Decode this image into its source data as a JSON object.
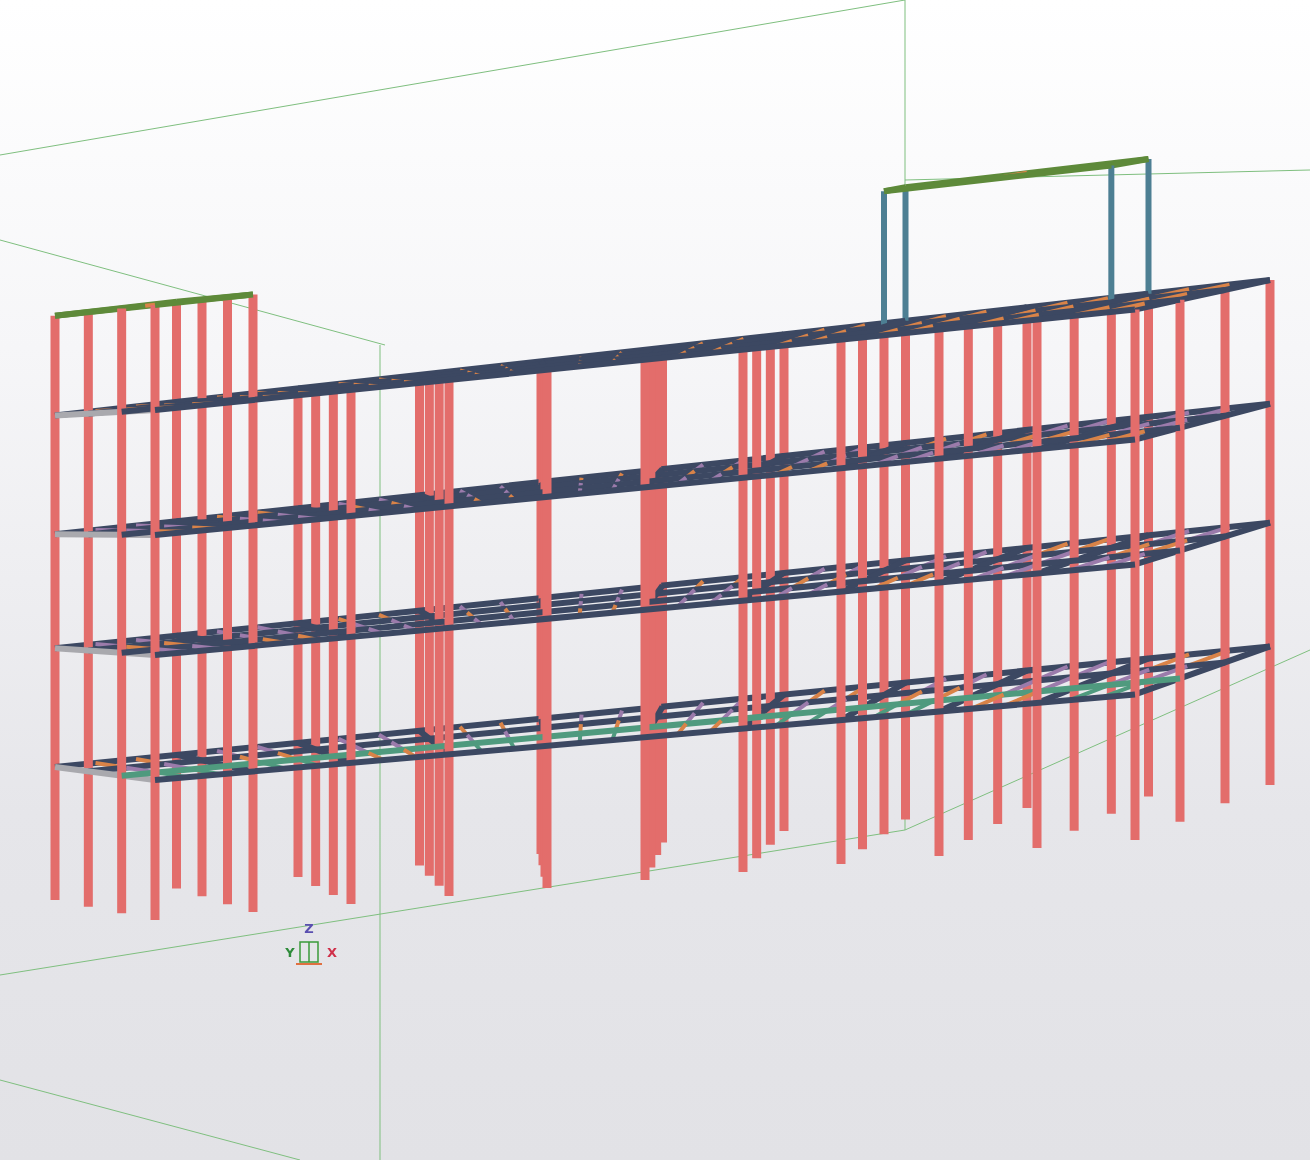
{
  "viewport": {
    "axis_labels": [
      {
        "label": "Z",
        "color": "#5a4fb0"
      },
      {
        "label": "Y",
        "color": "#2e8b3a"
      },
      {
        "label": "X",
        "color": "#d0304a"
      }
    ]
  }
}
